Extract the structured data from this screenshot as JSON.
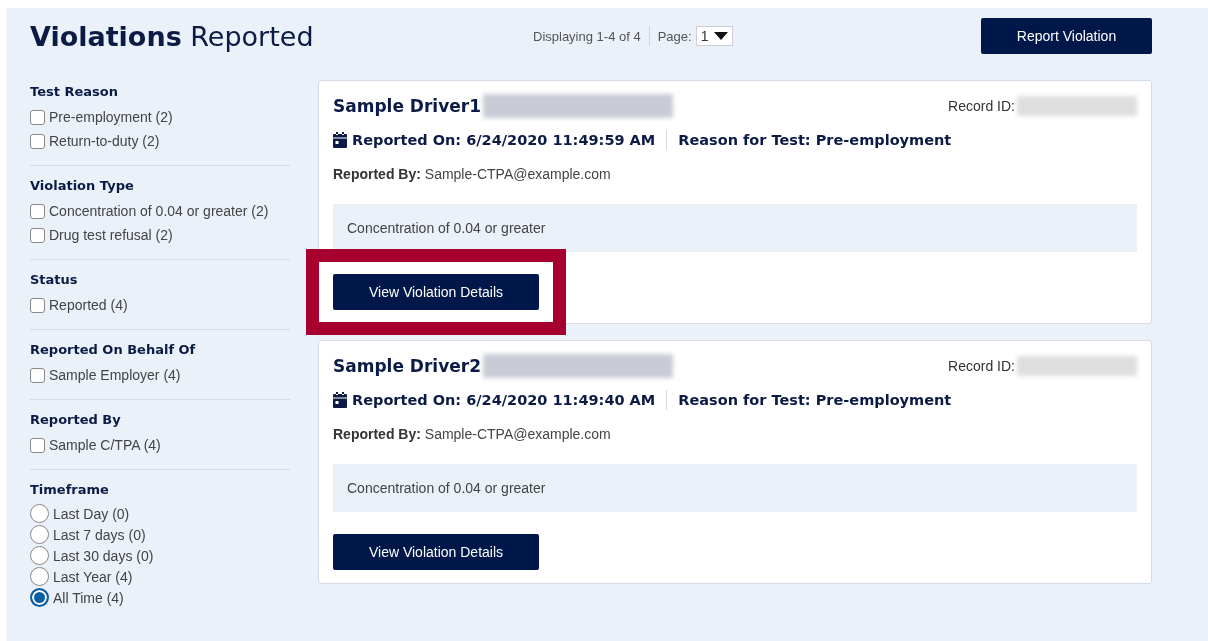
{
  "title": "**Violations** Reported",
  "pager": {
    "summary": "Displaying 1-4 of 4",
    "page_label": "Page:",
    "page_value": "1"
  },
  "report_button": "Report Violation",
  "filters": [
    {
      "heading": "Test Reason",
      "kind": "checkbox",
      "options": [
        {
          "label": "Pre-employment (2)",
          "checked": false
        },
        {
          "label": "Return-to-duty (2)",
          "checked": false
        }
      ]
    },
    {
      "heading": "Violation Type",
      "kind": "checkbox",
      "options": [
        {
          "label": "Concentration of 0.04 or greater (2)",
          "checked": false
        },
        {
          "label": "Drug test refusal (2)",
          "checked": false
        }
      ]
    },
    {
      "heading": "Status",
      "kind": "checkbox",
      "options": [
        {
          "label": "Reported (4)",
          "checked": false
        }
      ]
    },
    {
      "heading": "Reported On Behalf Of",
      "kind": "checkbox",
      "options": [
        {
          "label": "Sample Employer (4)",
          "checked": false
        }
      ]
    },
    {
      "heading": "Reported By",
      "kind": "checkbox",
      "options": [
        {
          "label": "Sample C/TPA (4)",
          "checked": false
        }
      ]
    },
    {
      "heading": "Timeframe",
      "kind": "radio",
      "options": [
        {
          "label": "Last Day (0)",
          "selected": false
        },
        {
          "label": "Last 7 days (0)",
          "selected": false
        },
        {
          "label": "Last 30 days (0)",
          "selected": false
        },
        {
          "label": "Last Year (4)",
          "selected": false
        },
        {
          "label": "All Time (4)",
          "selected": true
        }
      ]
    }
  ],
  "cards": [
    {
      "driver": "Sample Driver1",
      "name_redacted": true,
      "record_id_label": "Record ID:",
      "record_id_redacted": true,
      "reported_on": "Reported On: 6/24/2020 11:49:59 AM",
      "reason": "Reason for Test: Pre-employment",
      "reported_by": "**Reported By:** Sample-CTPA@example.com",
      "violation": "Concentration of 0.04 or greater",
      "button": "View Violation Details",
      "highlighted": true
    },
    {
      "driver": "Sample Driver2",
      "name_redacted": true,
      "record_id_label": "Record ID:",
      "record_id_redacted": true,
      "reported_on": "Reported On: 6/24/2020 11:49:40 AM",
      "reason": "Reason for Test: Pre-employment",
      "reported_by": "**Reported By:** Sample-CTPA@example.com",
      "violation": "Concentration of 0.04 or greater",
      "button": "View Violation Details",
      "highlighted": false
    }
  ]
}
